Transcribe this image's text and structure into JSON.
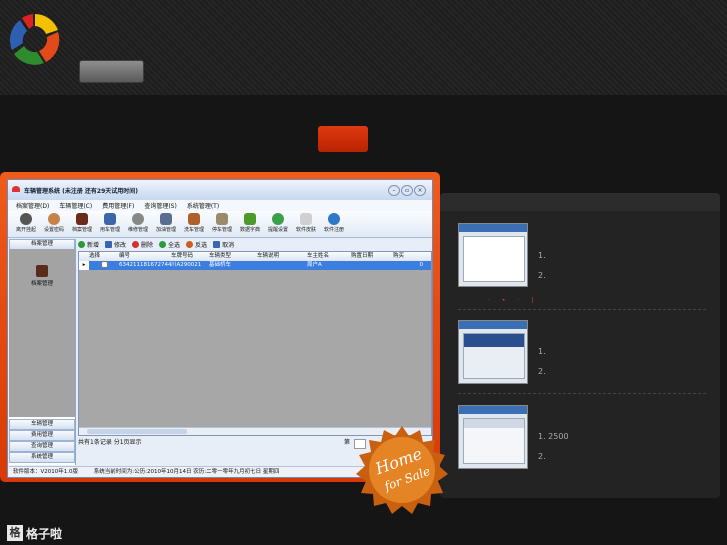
{
  "app": {
    "title": "车辆管理系统 (未注册 还有29天试用时间)",
    "menu": [
      "档案管理(D)",
      "车辆管理(C)",
      "费用管理(F)",
      "查询管理(S)",
      "系统管理(T)"
    ],
    "toolbar": [
      "离开挂起",
      "设置密码",
      "档案管理",
      "用车管理",
      "维修管理",
      "加油管理",
      "洗车管理",
      "停车管理",
      "数据字典",
      "提醒设置",
      "软件皮肤",
      "软件注册"
    ],
    "sidebar": {
      "active_tab": "档案管理",
      "item": "档案管理",
      "tabs": [
        "车辆管理",
        "费用管理",
        "查询管理",
        "系统管理"
      ]
    },
    "actions": [
      "新增",
      "修改",
      "删除",
      "全选",
      "反选",
      "取消"
    ],
    "columns": [
      "选择",
      "编号",
      "车牌号码",
      "车辆类型",
      "车辆说明",
      "车主姓名",
      "购置日期",
      "购买"
    ],
    "rows": [
      [
        "",
        "6342111816727441410",
        "川A290021",
        "基础桥车",
        "",
        "周户A",
        "",
        "0"
      ]
    ],
    "records": "共有1条记录   分1页显示",
    "page_label": "第",
    "version": "软件版本：V2010年1.0版",
    "system_time": "系统当前时间为:公历:2010年10月14日 农历:二零一零年九月初七日 星期四",
    "window_buttons": [
      "–",
      "▫",
      "×"
    ]
  },
  "news": [
    {
      "items": [
        "1.",
        "2."
      ]
    },
    {
      "items": [
        "1.",
        "2."
      ]
    },
    {
      "items": [
        "1.  2500",
        "2."
      ]
    }
  ],
  "badge": {
    "line1": "Home",
    "line2": "for Sale"
  },
  "footer": {
    "logo_char": "格",
    "name": "格子啦"
  },
  "colors": {
    "accent": "#d83a05",
    "button_red": "#cc2a05"
  }
}
